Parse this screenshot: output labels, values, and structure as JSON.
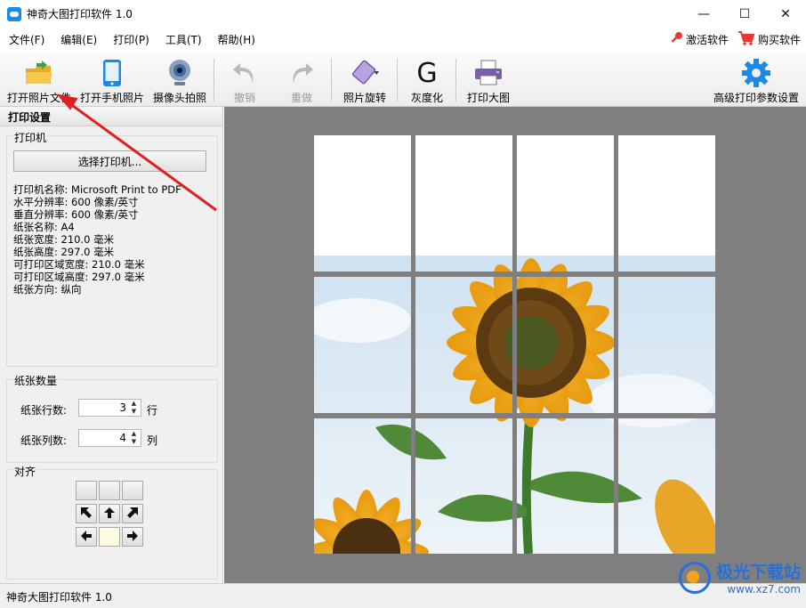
{
  "window": {
    "title": "神奇大图打印软件 1.0",
    "minimize": "—",
    "maximize": "☐",
    "close": "✕"
  },
  "menu": {
    "items": [
      "文件(F)",
      "编辑(E)",
      "打印(P)",
      "工具(T)",
      "帮助(H)"
    ],
    "activate": "激活软件",
    "buy": "购买软件"
  },
  "toolbar": {
    "open_file": "打开照片文件",
    "open_phone": "打开手机照片",
    "camera": "摄像头拍照",
    "undo": "撤销",
    "redo": "重做",
    "rotate": "照片旋转",
    "grayscale": "灰度化",
    "print_big": "打印大图",
    "advanced": "高级打印参数设置",
    "grayscale_glyph": "G"
  },
  "left_panel": {
    "title": "打印设置",
    "printer_group": "打印机",
    "select_printer": "选择打印机...",
    "info": [
      "打印机名称: Microsoft Print to PDF",
      "水平分辨率: 600 像素/英寸",
      "垂直分辨率: 600 像素/英寸",
      "纸张名称: A4",
      "纸张宽度: 210.0 毫米",
      "纸张高度: 297.0 毫米",
      "可打印区域宽度: 210.0 毫米",
      "可打印区域高度: 297.0 毫米",
      "纸张方向: 纵向"
    ],
    "paper_count_group": "纸张数量",
    "rows_label": "纸张行数:",
    "rows_value": "3",
    "rows_unit": "行",
    "cols_label": "纸张列数:",
    "cols_value": "4",
    "cols_unit": "列",
    "align_group": "对齐"
  },
  "status": {
    "text": "神奇大图打印软件 1.0"
  },
  "watermark": {
    "line1": "极光下载站",
    "line2": "www.xz7.com"
  },
  "colors": {
    "accent_blue": "#1e88e5",
    "arrow_red": "#e02020",
    "canvas_bg": "#7f7f7f"
  }
}
